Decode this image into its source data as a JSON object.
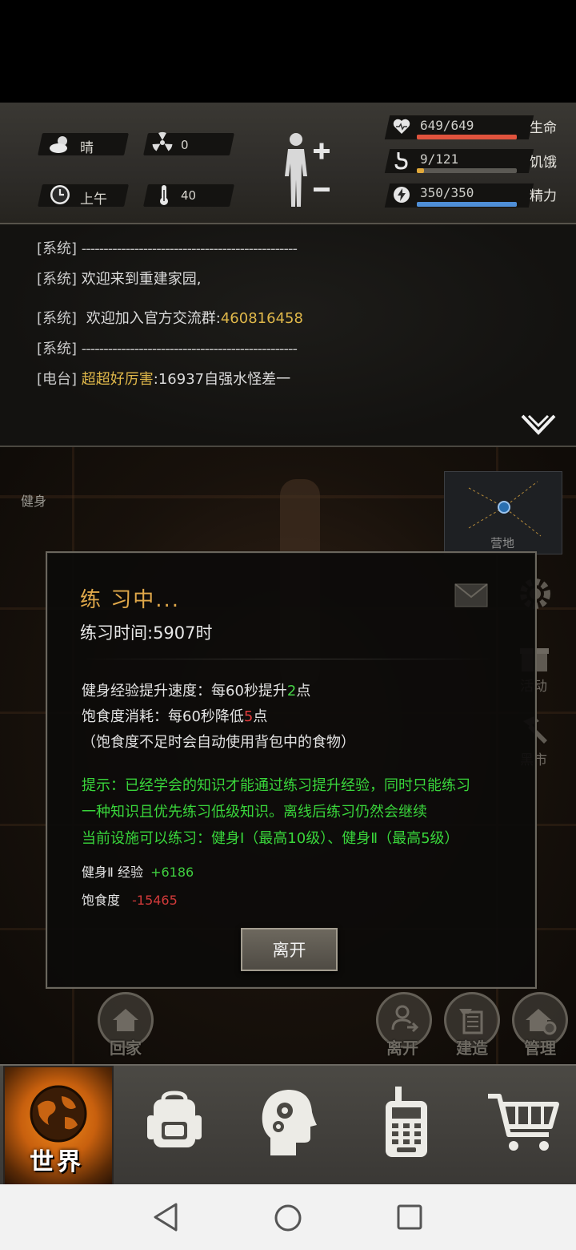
{
  "hud": {
    "weather": "晴",
    "radiation": "0",
    "time_of_day": "上午",
    "temperature": "40",
    "health": {
      "value": "649/649",
      "label": "生命",
      "fraction": 1.0,
      "color": "#e0533d"
    },
    "hunger": {
      "value": "9/121",
      "label": "饥饿",
      "fraction": 0.074,
      "color": "#e0a83a"
    },
    "energy": {
      "value": "350/350",
      "label": "精力",
      "fraction": 1.0,
      "color": "#4f8fd8"
    }
  },
  "log": {
    "lines": [
      {
        "tag": "[系统]",
        "text": "-------------------------------------------------"
      },
      {
        "tag": "[系统]",
        "text": "欢迎来到重建家园,"
      },
      {
        "tag": "[系统]",
        "text": "欢迎加入官方交流群:",
        "highlight": "460816458"
      },
      {
        "tag": "[系统]",
        "text": "-------------------------------------------------"
      },
      {
        "tag": "[电台]",
        "speaker": "超超好厉害",
        "text": ":16937自强水怪差一"
      }
    ]
  },
  "scene": {
    "title": "健身",
    "map_label": "营地",
    "side_activity": "活动",
    "side_blackmarket": "黑市"
  },
  "dialog": {
    "title": "练 习中...",
    "practice_time": "练习时间:5907时",
    "exp_rate_prefix": "健身经验提升速度：每60秒提升",
    "exp_rate_value": "2",
    "exp_rate_suffix": "点",
    "hunger_rate_prefix": "饱食度消耗：每60秒降低",
    "hunger_rate_value": "5",
    "hunger_rate_suffix": "点",
    "note": "（饱食度不足时会自动使用背包中的食物）",
    "tip_line1": "提示：已经学会的知识才能通过练习提升经验，同时只能练习",
    "tip_line2": "一种知识且优先练习低级知识。离线后练习仍然会继续",
    "tip_line3": "当前设施可以练习：健身Ⅰ（最高10级）、健身Ⅱ（最高5级）",
    "exp_label": "健身Ⅱ 经验",
    "exp_value": "+6186",
    "satiety_label": "饱食度",
    "satiety_value": "-15465",
    "leave_button": "离开"
  },
  "actions": {
    "home": "回家",
    "leave": "离开",
    "build": "建造",
    "manage": "管理"
  },
  "nav": {
    "world": "世界"
  }
}
